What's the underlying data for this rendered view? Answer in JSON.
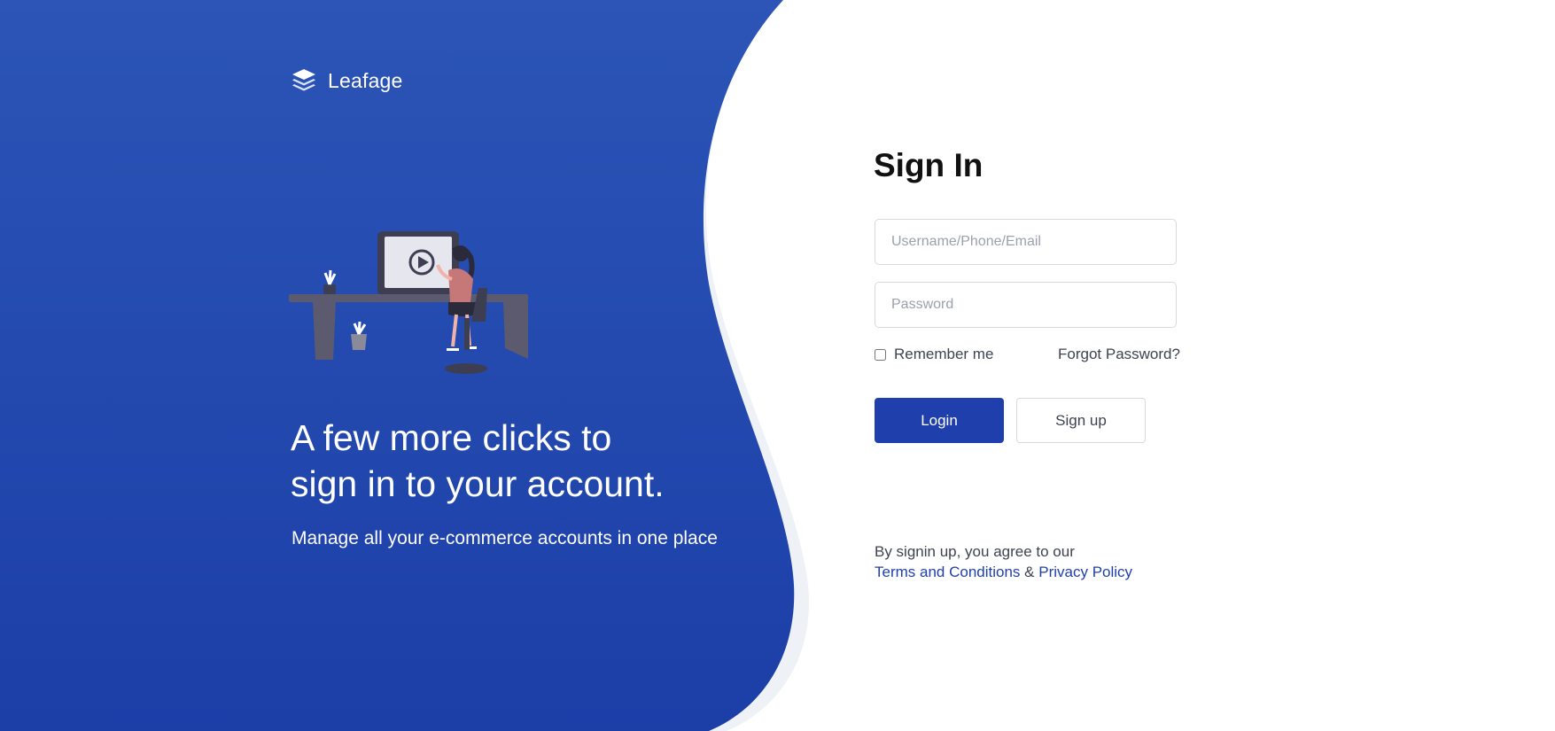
{
  "brand": {
    "name": "Leafage",
    "logo_icon": "layers-icon"
  },
  "hero": {
    "illustration_icon": "woman-at-desk-illustration",
    "headline_line1": "A few more clicks to",
    "headline_line2": "sign in to your account.",
    "subheadline": "Manage all your e-commerce accounts in one place"
  },
  "form": {
    "title": "Sign In",
    "username_placeholder": "Username/Phone/Email",
    "username_value": "",
    "password_placeholder": "Password",
    "password_value": "",
    "remember_label": "Remember me",
    "remember_checked": false,
    "forgot_label": "Forgot Password?",
    "login_label": "Login",
    "signup_label": "Sign up"
  },
  "legal": {
    "prefix": "By signin up, you agree to our",
    "terms_label": "Terms and Conditions",
    "separator": "&",
    "privacy_label": "Privacy Policy"
  },
  "colors": {
    "brand_blue": "#1f3fad",
    "panel_blue_top": "#2c55b7",
    "panel_blue_bottom": "#1b3ea7",
    "wave_shadow": "#eef2f7"
  }
}
